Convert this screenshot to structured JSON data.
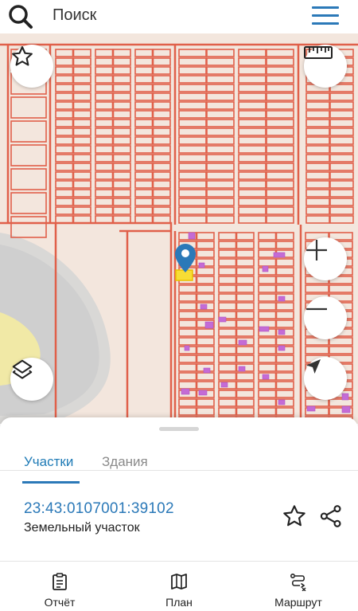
{
  "search": {
    "placeholder": "Поиск"
  },
  "tabs": [
    {
      "label": "Участки",
      "active": true
    },
    {
      "label": "Здания",
      "active": false
    }
  ],
  "parcel": {
    "cadastral_number": "23:43:0107001:39102",
    "type": "Земельный участок"
  },
  "bottom_nav": [
    {
      "label": "Отчёт",
      "icon": "report-icon"
    },
    {
      "label": "План",
      "icon": "map-plan-icon"
    },
    {
      "label": "Маршрут",
      "icon": "route-icon"
    }
  ],
  "colors": {
    "accent": "#2b79b8",
    "parcel_lines": "#e0604a",
    "map_background": "#f3e6dd",
    "building": "#c46bd6",
    "selected_parcel": "#f7dd35"
  }
}
